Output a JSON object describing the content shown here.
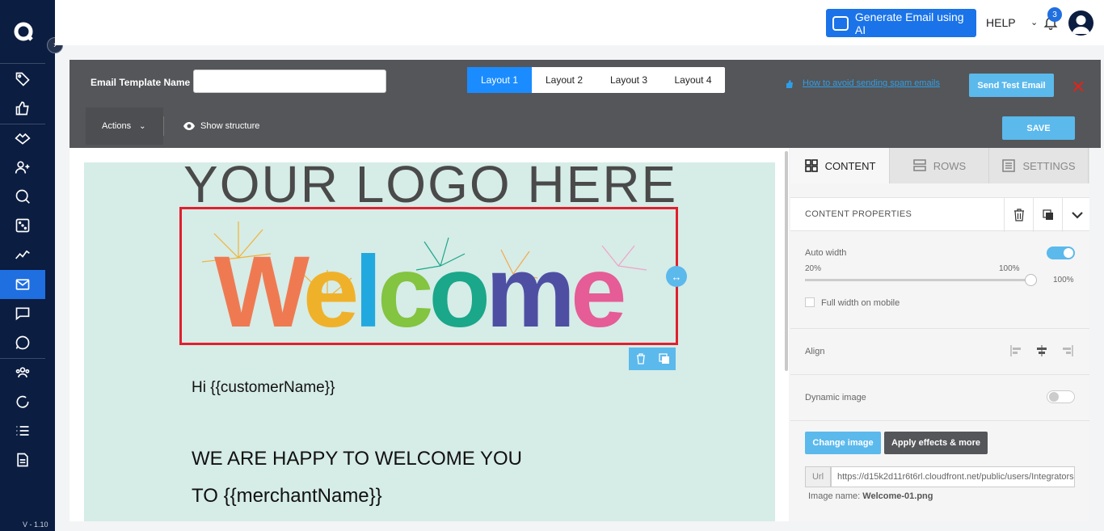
{
  "topbar": {
    "generate_ai_label": "Generate Email using AI",
    "help_label": "HELP",
    "notification_count": "3"
  },
  "sidebar": {
    "version": "V - 1.10",
    "items": [
      "tag-icon",
      "thumbs-up-icon",
      "handshake-icon",
      "add-user-icon",
      "search-globe-icon",
      "dice-icon",
      "analytics-icon",
      "mail-icon",
      "chat-icon",
      "whatsapp-icon",
      "group-icon",
      "refresh-icon",
      "list-icon",
      "document-icon"
    ],
    "active_item": "mail-icon"
  },
  "editor": {
    "template_name_label": "Email Template Name",
    "template_name_value": "",
    "layouts": [
      "Layout 1",
      "Layout 2",
      "Layout 3",
      "Layout 4"
    ],
    "active_layout": "Layout 1",
    "spam_link": "How to avoid sending spam emails",
    "send_test_label": "Send Test Email",
    "actions_label": "Actions",
    "show_structure_label": "Show structure",
    "save_label": "SAVE"
  },
  "email": {
    "logo_text": "YOUR LOGO HERE",
    "welcome_text": "Welcome",
    "greeting": "Hi {{customerName}}",
    "line1": "WE ARE HAPPY TO WELCOME YOU",
    "line2": "TO {{merchantName}}"
  },
  "panel": {
    "tabs": [
      "CONTENT",
      "ROWS",
      "SETTINGS"
    ],
    "active_tab": "CONTENT",
    "properties_title": "CONTENT PROPERTIES",
    "auto_width_label": "Auto width",
    "auto_width_on": true,
    "slider_min": "20%",
    "slider_max": "100%",
    "slider_value": "100%",
    "full_width_mobile_label": "Full width on mobile",
    "align_label": "Align",
    "dynamic_image_label": "Dynamic image",
    "dynamic_image_on": false,
    "change_image_label": "Change image",
    "apply_effects_label": "Apply effects & more",
    "url_label": "Url",
    "url_value": "https://d15k2d11r6t6rl.cloudfront.net/public/users/Integrators",
    "image_name_label": "Image name:",
    "image_name_value": "Welcome-01.png"
  },
  "colors": {
    "sidebar_bg": "#0b1d40",
    "accent": "#1a73e8",
    "editor_header": "#545659",
    "email_bg": "#d6ece7",
    "selection": "#e21f2d",
    "light_blue": "#5bb9ec"
  }
}
